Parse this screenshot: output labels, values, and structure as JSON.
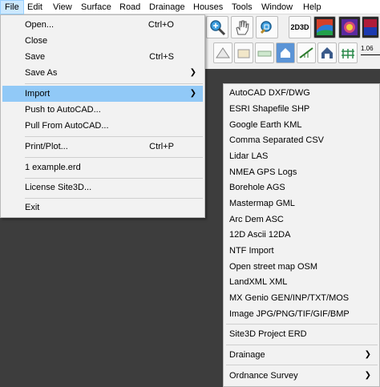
{
  "menubar": {
    "items": [
      "File",
      "Edit",
      "View",
      "Surface",
      "Road",
      "Drainage",
      "Houses",
      "Tools",
      "Window",
      "Help"
    ]
  },
  "toolbar": {
    "label_2d3d": "2D3D",
    "scale_label": "1.06"
  },
  "file_menu": {
    "open": {
      "label": "Open...",
      "shortcut": "Ctrl+O"
    },
    "close": {
      "label": "Close"
    },
    "save": {
      "label": "Save",
      "shortcut": "Ctrl+S"
    },
    "save_as": {
      "label": "Save As"
    },
    "import": {
      "label": "Import"
    },
    "push_autocad": {
      "label": "Push to AutoCAD..."
    },
    "pull_autocad": {
      "label": "Pull From AutoCAD..."
    },
    "print": {
      "label": "Print/Plot...",
      "shortcut": "Ctrl+P"
    },
    "recent": {
      "label": "1 example.erd"
    },
    "license": {
      "label": "License Site3D..."
    },
    "exit": {
      "label": "Exit"
    }
  },
  "import_menu": {
    "items": [
      "AutoCAD DXF/DWG",
      "ESRI Shapefile SHP",
      "Google Earth KML",
      "Comma Separated CSV",
      "Lidar LAS",
      "NMEA GPS Logs",
      "Borehole AGS",
      "Mastermap GML",
      "Arc Dem ASC",
      "12D Ascii 12DA",
      "NTF Import",
      "Open street map OSM",
      "LandXML XML",
      "MX Genio GEN/INP/TXT/MOS",
      "Image JPG/PNG/TIF/GIF/BMP"
    ],
    "project": "Site3D Project ERD",
    "drainage": "Drainage",
    "ordnance": "Ordnance Survey"
  },
  "colors": {
    "menu_bg": "#f2f2f2",
    "highlight": "#91c9f7",
    "menubar_active": "#cce8ff",
    "workspace": "#3d3d3d"
  }
}
